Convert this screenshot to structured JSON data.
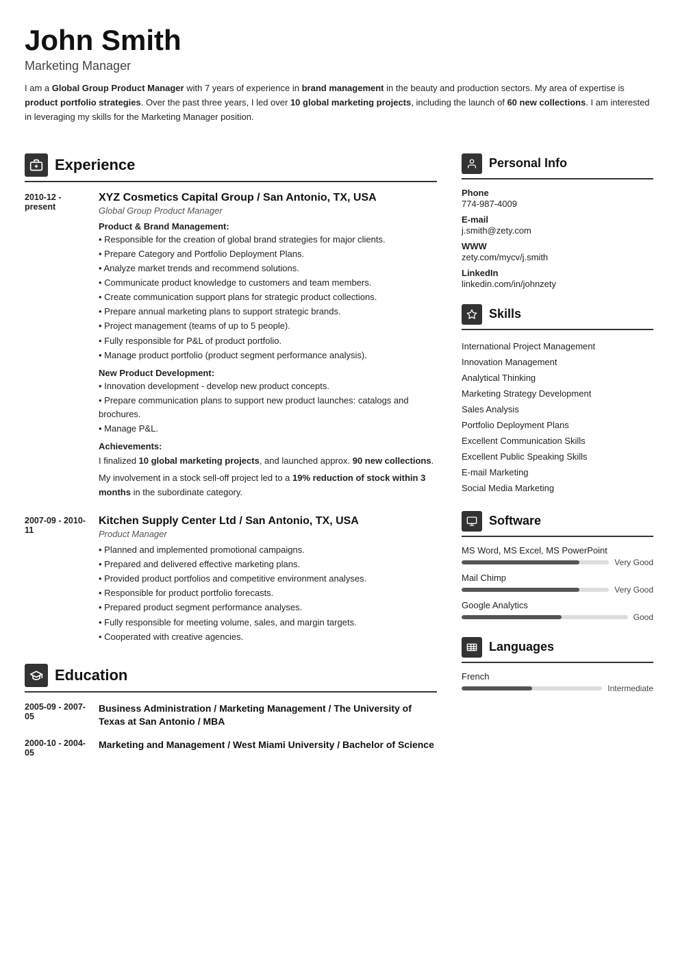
{
  "header": {
    "name": "John Smith",
    "job_title": "Marketing Manager",
    "summary": "I am a <b>Global Group Product Manager</b> with 7 years of experience in <b>brand management</b> in the beauty and production sectors. My area of expertise is <b>product portfolio strategies</b>. Over the past three years, I led over <b>10 global marketing projects</b>, including the launch of <b>60 new collections</b>. I am interested in leveraging my skills for the Marketing Manager position."
  },
  "sections": {
    "experience_label": "Experience",
    "education_label": "Education",
    "personal_info_label": "Personal Info",
    "skills_label": "Skills",
    "software_label": "Software",
    "languages_label": "Languages"
  },
  "experience": [
    {
      "dates": "2010-12 - present",
      "company": "XYZ Cosmetics Capital Group / San Antonio, TX, USA",
      "role": "Global Group Product Manager",
      "subsections": [
        {
          "title": "Product & Brand Management:",
          "bullets": [
            "Responsible for the creation of global brand strategies for major clients.",
            "Prepare Category and Portfolio Deployment Plans.",
            "Analyze market trends and recommend solutions.",
            "Communicate product knowledge to customers and team members.",
            "Create communication support plans for strategic product collections.",
            "Prepare annual marketing plans to support strategic brands.",
            "Project management (teams of up to 5 people).",
            "Fully responsible for P&L of product portfolio.",
            "Manage product portfolio (product segment performance analysis)."
          ]
        },
        {
          "title": "New Product Development:",
          "bullets": [
            "Innovation development - develop new product concepts.",
            "Prepare communication plans to support new product launches: catalogs and brochures.",
            "Manage P&L."
          ]
        },
        {
          "title": "Achievements:",
          "achievements": [
            "I finalized <b>10 global marketing projects</b>, and launched approx. <b>90 new collections</b>.",
            "My involvement in a stock sell-off project led to a <b>19% reduction of stock within 3 months</b> in the subordinate category."
          ]
        }
      ]
    },
    {
      "dates": "2007-09 - 2010-11",
      "company": "Kitchen Supply Center Ltd / San Antonio, TX, USA",
      "role": "Product Manager",
      "subsections": [
        {
          "title": null,
          "bullets": [
            "Planned and implemented promotional campaigns.",
            "Prepared and delivered effective marketing plans.",
            "Provided product portfolios and competitive environment analyses.",
            "Responsible for product portfolio forecasts.",
            "Prepared product segment performance analyses.",
            "Fully responsible for meeting volume, sales, and margin targets.",
            "Cooperated with creative agencies."
          ]
        }
      ]
    }
  ],
  "education": [
    {
      "dates": "2005-09 - 2007-05",
      "degree": "Business Administration / Marketing Management / The University of Texas at San Antonio / MBA"
    },
    {
      "dates": "2000-10 - 2004-05",
      "degree": "Marketing and Management / West Miami University / Bachelor of Science"
    }
  ],
  "personal_info": {
    "phone_label": "Phone",
    "phone": "774-987-4009",
    "email_label": "E-mail",
    "email": "j.smith@zety.com",
    "www_label": "WWW",
    "www": "zety.com/mycv/j.smith",
    "linkedin_label": "LinkedIn",
    "linkedin": "linkedin.com/in/johnzety"
  },
  "skills": [
    "International Project Management",
    "Innovation Management",
    "Analytical Thinking",
    "Marketing Strategy Development",
    "Sales Analysis",
    "Portfolio Deployment Plans",
    "Excellent Communication Skills",
    "Excellent Public Speaking Skills",
    "E-mail Marketing",
    "Social Media Marketing"
  ],
  "software": [
    {
      "name": "MS Word, MS Excel, MS PowerPoint",
      "level": "Very Good",
      "percent": 80
    },
    {
      "name": "Mail Chimp",
      "level": "Very Good",
      "percent": 80
    },
    {
      "name": "Google Analytics",
      "level": "Good",
      "percent": 60
    }
  ],
  "languages": [
    {
      "name": "French",
      "level": "Intermediate",
      "percent": 50
    }
  ]
}
